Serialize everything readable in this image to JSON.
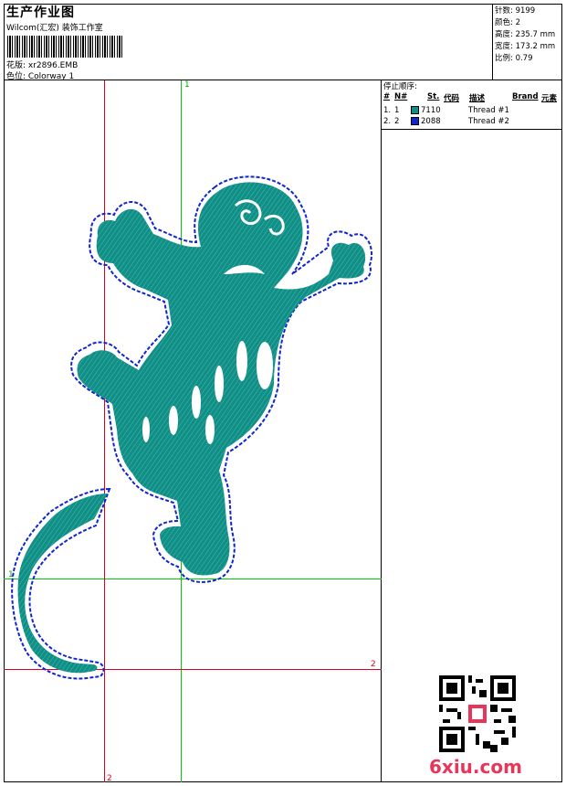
{
  "header": {
    "title": "生产作业图",
    "company": "Wilcom(汇宏) 装饰工作室",
    "design_label": "花版: xr2896.EMB",
    "colorway_label": "色位: Colorway 1"
  },
  "specs": {
    "stitches": "针数: 9199",
    "colors": "颜色: 2",
    "height": "高度: 235.7 mm",
    "width": "宽度: 173.2 mm",
    "scale": "比例: 0.79"
  },
  "stop_sequence": {
    "title": "停止顺序:",
    "columns": [
      "#",
      "N#",
      "St.",
      "代码",
      "描述",
      "Brand",
      "元素"
    ],
    "rows": [
      {
        "num": "1.",
        "n": "1",
        "code": "7110",
        "desc": "Thread #1",
        "swatch": "#0f8f86"
      },
      {
        "num": "2.",
        "n": "2",
        "code": "2088",
        "desc": "Thread #2",
        "swatch": "#1024cf"
      }
    ]
  },
  "guides": {
    "green_top": "1",
    "green_left": "1",
    "red_right": "2",
    "red_bottom": "2",
    "green_color": "#00cc00",
    "red_color": "#e0001c"
  },
  "design_colors": {
    "fill": "#0f8f86",
    "outline": "#1024cf"
  },
  "watermark": "6xiu.com"
}
